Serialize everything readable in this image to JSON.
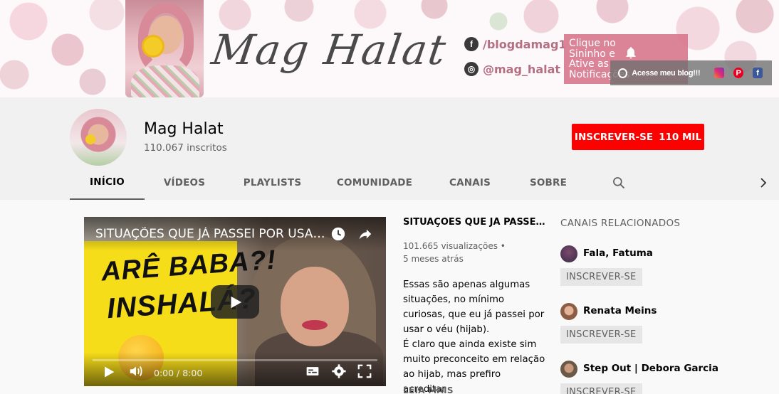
{
  "banner": {
    "title": "Mag Halat",
    "facebook_handle": "/blogdamag1",
    "instagram_handle": "@mag_halat",
    "notify_text": "Clique no Sininho e Ative as Notificações",
    "links_label": "Acesse meu blog!!!",
    "notify_color": "#d9798f"
  },
  "channel": {
    "name": "Mag Halat",
    "subscribers": "110.067 inscritos",
    "subscribe_label": "INSCREVER-SE",
    "subscribe_count": "110 MIL",
    "accent": "#ff0000"
  },
  "tabs": [
    {
      "label": "INÍCIO",
      "active": true
    },
    {
      "label": "VÍDEOS",
      "active": false
    },
    {
      "label": "PLAYLISTS",
      "active": false
    },
    {
      "label": "COMUNIDADE",
      "active": false
    },
    {
      "label": "CANAIS",
      "active": false
    },
    {
      "label": "SOBRE",
      "active": false
    }
  ],
  "featured_video": {
    "player_title": "SITUAÇÕES QUE JÁ PASSEI POR USAR O VÉU",
    "thumbnail_text_1": "ARÊ BABA?!",
    "thumbnail_text_2": "INSHALÁ?",
    "time": "0:00 / 8:00",
    "progress": 0,
    "info_title": "SITUAÇÕES QUE JÁ PASSEI POR USAR O VÉU",
    "views": "101.665 visualizações",
    "age": "5 meses atrás",
    "description": [
      "Essas são apenas algumas situações, no mínimo curiosas, que eu já passei por usar o véu (hijab).",
      "É claro que ainda existe sim muito preconceito em relação ao hijab, mas prefiro acreditar"
    ],
    "read_more": "LEIA MAIS"
  },
  "related": {
    "heading": "CANAIS RELACIONADOS",
    "items": [
      {
        "name": "Fala, Fatuma",
        "button": "INSCREVER-SE"
      },
      {
        "name": "Renata Meins",
        "button": "INSCREVER-SE"
      },
      {
        "name": "Step Out | Debora Garcia",
        "button": "INSCREVER-SE"
      }
    ]
  }
}
